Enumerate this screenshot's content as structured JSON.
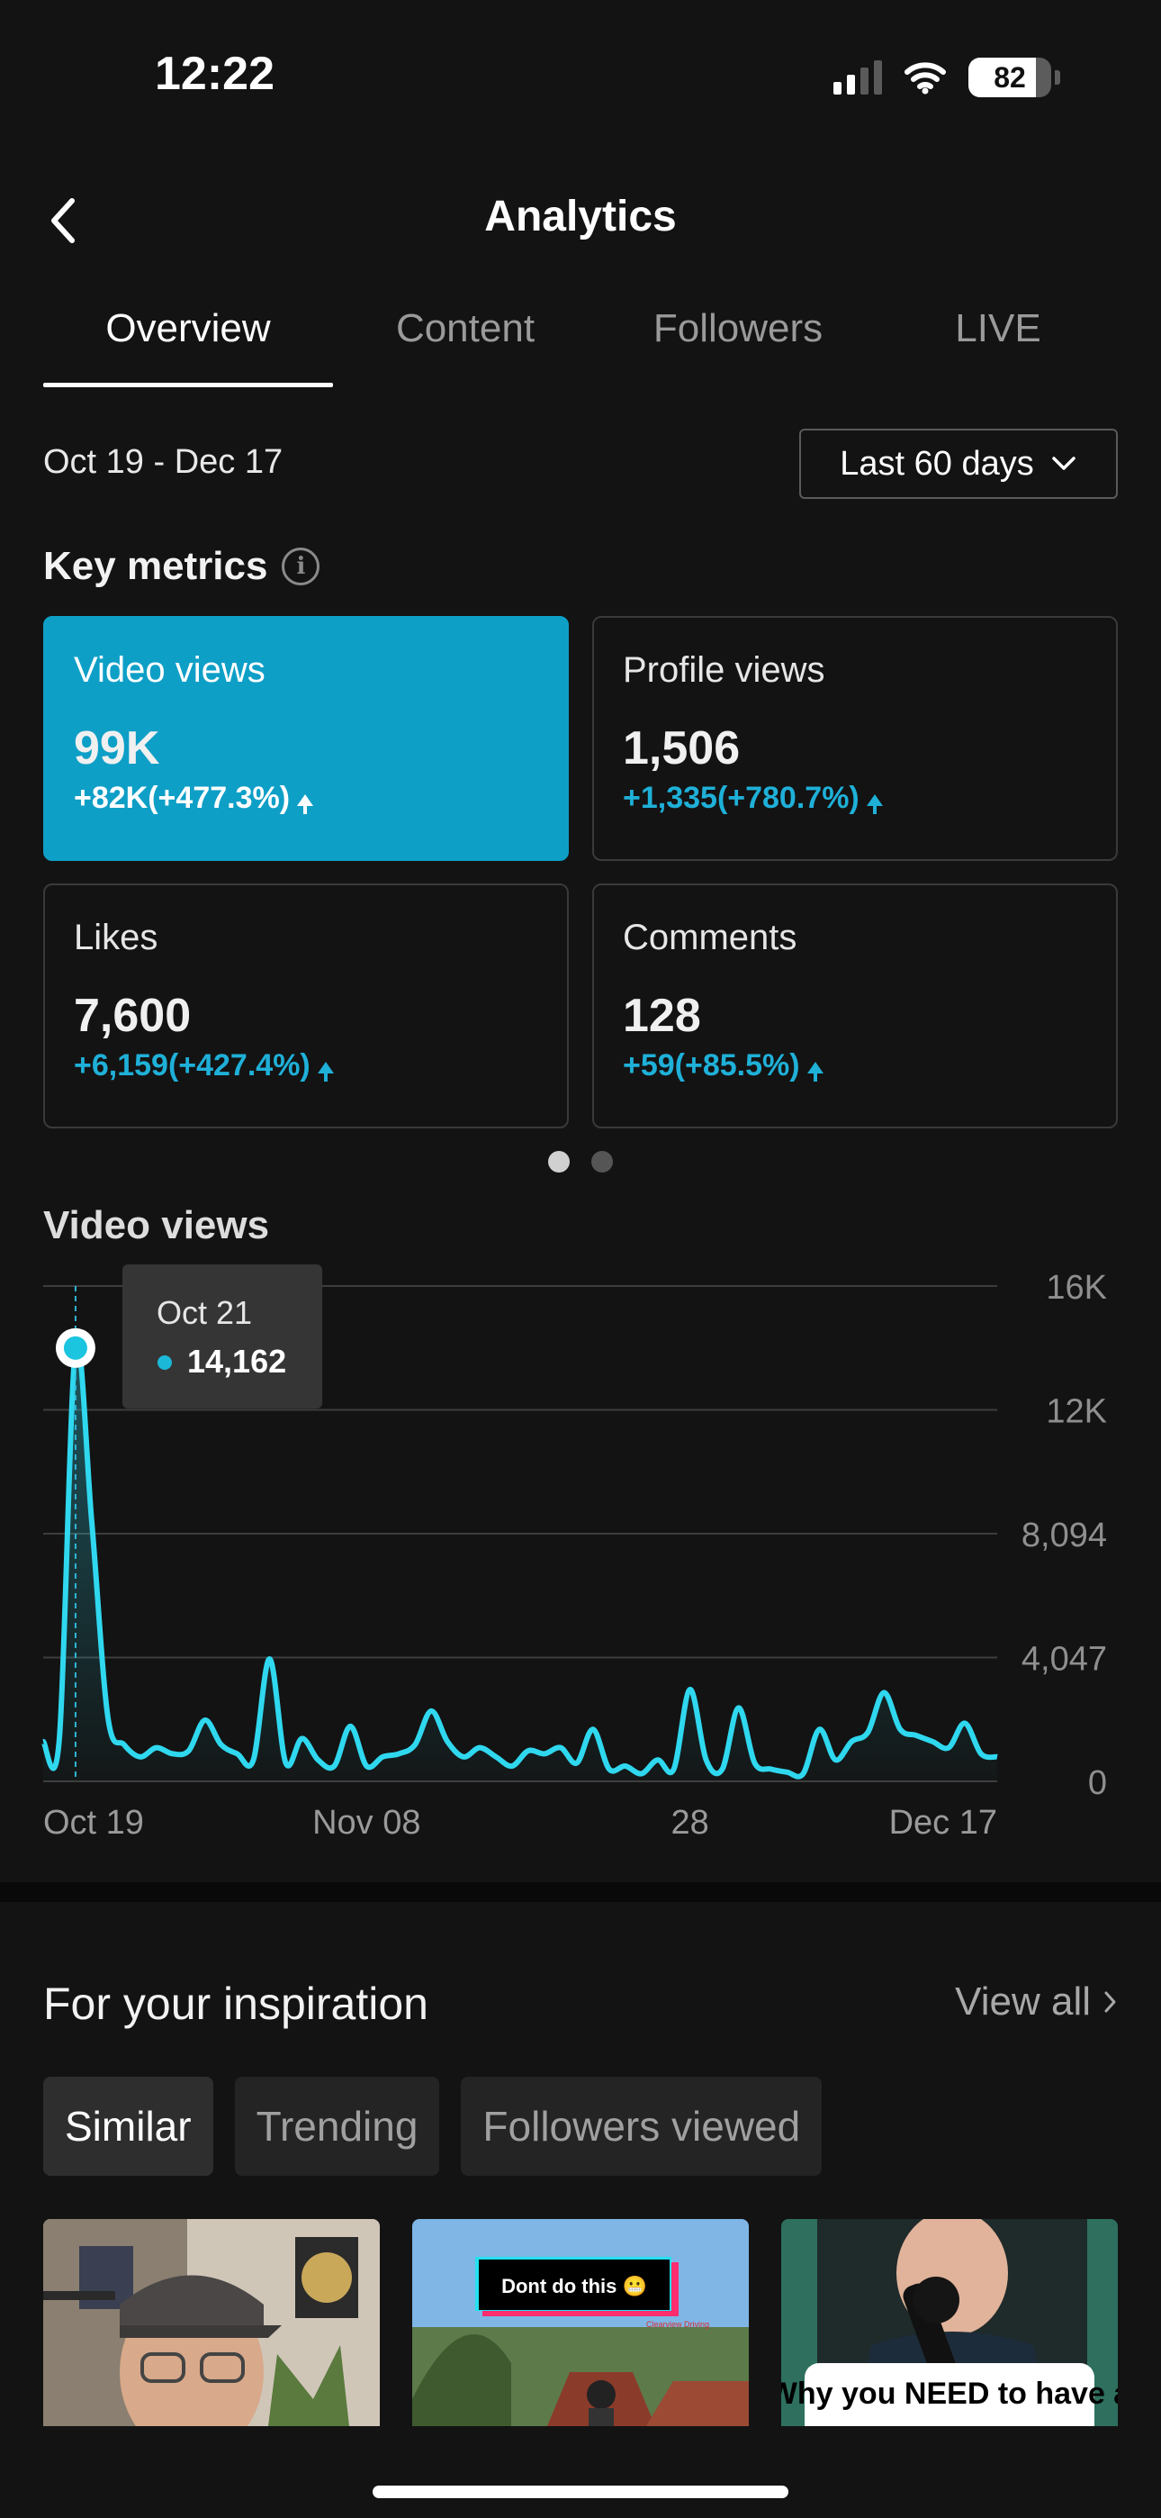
{
  "status_bar": {
    "time": "12:22",
    "battery": "82",
    "battery_level": 0.82
  },
  "header": {
    "title": "Analytics"
  },
  "tabs": [
    {
      "label": "Overview",
      "active": true
    },
    {
      "label": "Content",
      "active": false
    },
    {
      "label": "Followers",
      "active": false
    },
    {
      "label": "LIVE",
      "active": false
    }
  ],
  "date_range": "Oct 19 - Dec 17",
  "period_selector": {
    "label": "Last 60 days"
  },
  "key_metrics": {
    "title": "Key metrics",
    "cards": [
      {
        "label": "Video views",
        "value": "99K",
        "change": "+82K(+477.3%)",
        "active": true
      },
      {
        "label": "Profile views",
        "value": "1,506",
        "change": "+1,335(+780.7%)",
        "active": false
      },
      {
        "label": "Likes",
        "value": "7,600",
        "change": "+6,159(+427.4%)",
        "active": false
      },
      {
        "label": "Comments",
        "value": "128",
        "change": "+59(+85.5%)",
        "active": false
      }
    ],
    "page_count": 2,
    "active_page": 0
  },
  "video_views_section": {
    "title": "Video views"
  },
  "chart_data": {
    "type": "area",
    "xlabel": "",
    "ylabel": "",
    "ylim": [
      0,
      16188
    ],
    "y_ticks": [
      {
        "value": 16188,
        "label": "16K"
      },
      {
        "value": 12141,
        "label": "12K"
      },
      {
        "value": 8094,
        "label": "8,094"
      },
      {
        "value": 4047,
        "label": "4,047"
      },
      {
        "value": 0,
        "label": "0"
      }
    ],
    "x_tick_labels": [
      {
        "day": 0,
        "label": "Oct 19"
      },
      {
        "day": 20,
        "label": "Nov 08"
      },
      {
        "day": 40,
        "label": "28"
      },
      {
        "day": 59,
        "label": "Dec 17"
      }
    ],
    "series": [
      {
        "values": [
          1300,
          1400,
          14162,
          8500,
          2100,
          1200,
          800,
          1100,
          900,
          1000,
          2000,
          1200,
          900,
          700,
          4000,
          600,
          1400,
          700,
          500,
          1800,
          500,
          800,
          900,
          1200,
          2300,
          1300,
          800,
          1100,
          800,
          500,
          1000,
          900,
          1100,
          600,
          1700,
          400,
          500,
          250,
          700,
          400,
          3000,
          700,
          400,
          2400,
          600,
          400,
          300,
          250,
          1700,
          700,
          1300,
          1600,
          2900,
          1700,
          1500,
          1300,
          1100,
          1900,
          900,
          800
        ],
        "color": "#2fd8ef"
      }
    ],
    "tooltip": {
      "day": 2,
      "date": "Oct 21",
      "value": "14,162"
    },
    "grid": true,
    "colors": {
      "line": "#2fd8ef",
      "gridline": "#3d3d3d"
    }
  },
  "inspiration": {
    "title": "For your inspiration",
    "view_all": "View all",
    "chips": [
      {
        "label": "Similar",
        "active": true
      },
      {
        "label": "Trending",
        "active": false
      },
      {
        "label": "Followers viewed",
        "active": false
      }
    ],
    "thumbnails": [
      {
        "caption": "",
        "subject": "man in cap and glasses"
      },
      {
        "caption": "Dont do this 😬",
        "watermark": "Clearview Driving",
        "subject": "cyclist on road"
      },
      {
        "caption": "Why you NEED to have a",
        "subject": "man at microphone"
      }
    ]
  },
  "colors": {
    "accent": "#0e9fc7",
    "background": "#131313",
    "positive": "#1fb0d8"
  }
}
